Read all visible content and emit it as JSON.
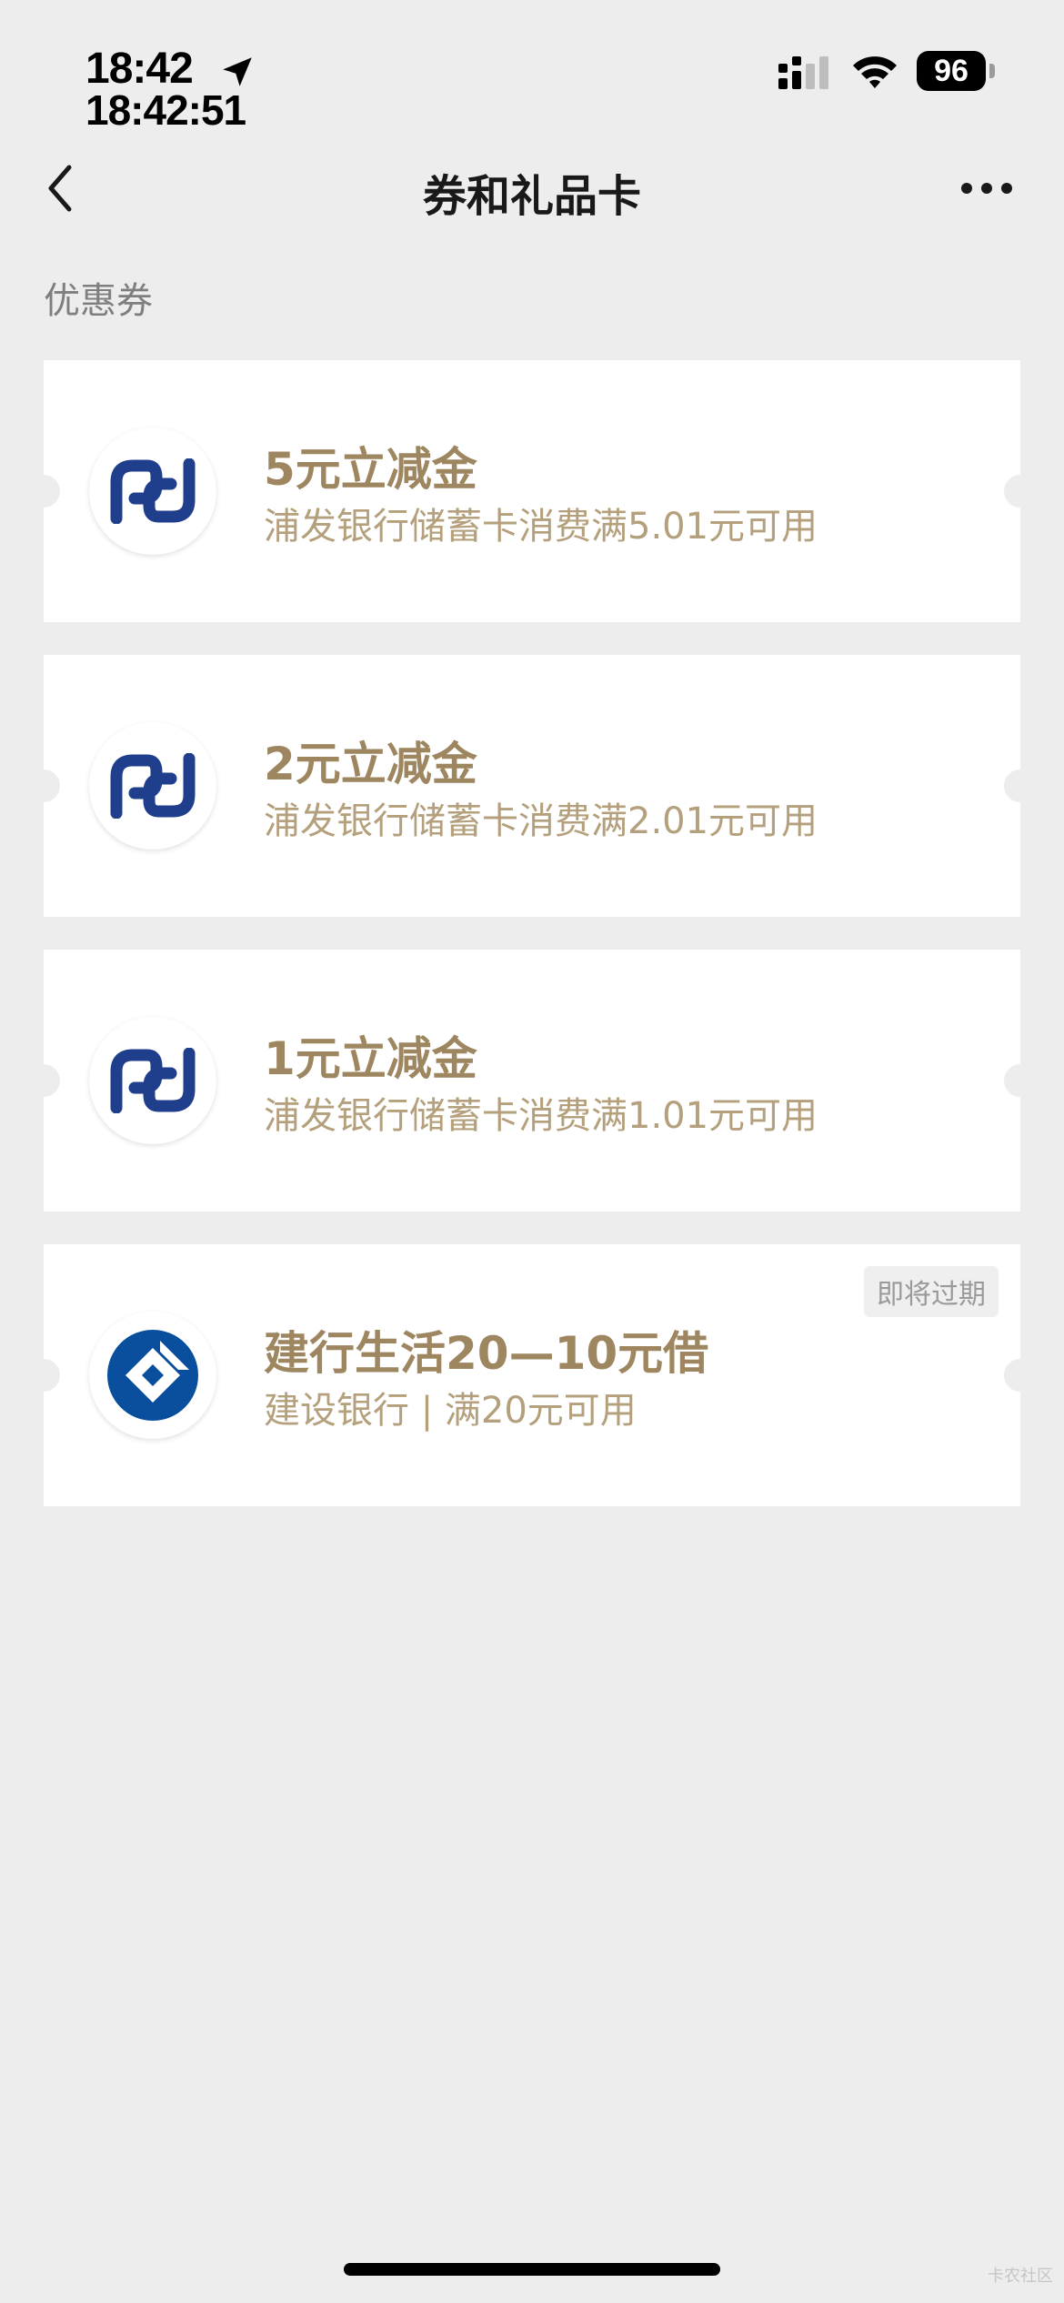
{
  "status_bar": {
    "time": "18:42",
    "time_detail": "18:42:51",
    "battery": "96",
    "icons": [
      "location-arrow-icon",
      "signal-icon",
      "wifi-icon",
      "battery-icon"
    ]
  },
  "nav": {
    "title": "券和礼品卡",
    "back_icon": "chevron-left-icon",
    "more_icon": "more-dots-icon"
  },
  "section_title": "优惠券",
  "coupons": [
    {
      "title": "5元立减金",
      "desc": "浦发银行储蓄卡消费满5.01元可用",
      "logo": "spdb-logo"
    },
    {
      "title": "2元立减金",
      "desc": "浦发银行储蓄卡消费满2.01元可用",
      "logo": "spdb-logo"
    },
    {
      "title": "1元立减金",
      "desc": "浦发银行储蓄卡消费满1.01元可用",
      "logo": "spdb-logo"
    },
    {
      "title": "建行生活20—10元借",
      "desc": "建设银行 | 满20元可用",
      "logo": "ccb-logo",
      "tag": "即将过期"
    }
  ],
  "watermark": "卡农社区",
  "colors": {
    "background": "#ededed",
    "card": "#ffffff",
    "coupon_title": "#9d8660",
    "coupon_desc": "#b4a07c",
    "spdb_blue": "#1f3e8c",
    "ccb_blue": "#0a4f9e"
  }
}
